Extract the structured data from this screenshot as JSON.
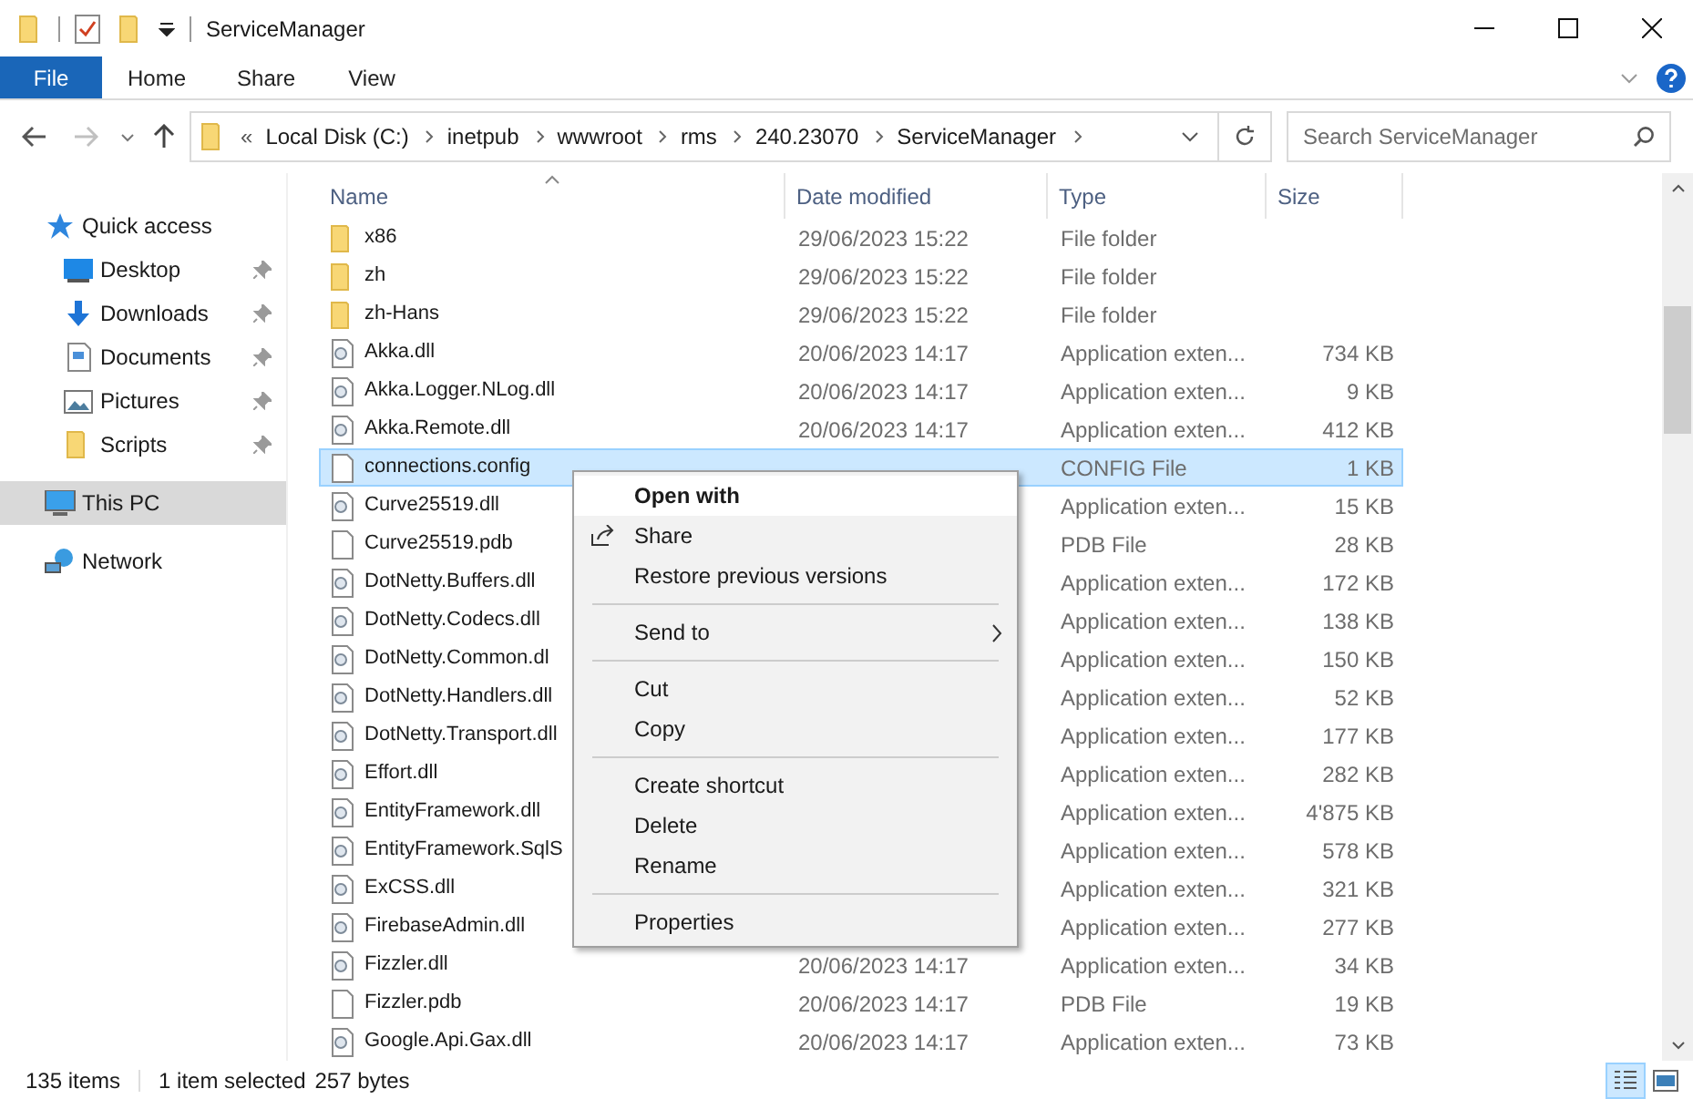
{
  "window": {
    "title": "ServiceManager"
  },
  "ribbon": {
    "tabs": [
      {
        "label": "File",
        "selected": true
      },
      {
        "label": "Home",
        "selected": false
      },
      {
        "label": "Share",
        "selected": false
      },
      {
        "label": "View",
        "selected": false
      }
    ]
  },
  "address": {
    "overflow": "«",
    "segments": [
      "Local Disk (C:)",
      "inetpub",
      "wwwroot",
      "rms",
      "240.23070",
      "ServiceManager"
    ],
    "search_placeholder": "Search ServiceManager"
  },
  "navigation": {
    "back_disabled": false,
    "forward_disabled": true
  },
  "sidebar": {
    "items": [
      {
        "label": "Quick access",
        "kind": "star",
        "selected": false,
        "children": [
          {
            "label": "Desktop",
            "kind": "desktop",
            "pinned": true,
            "selected": false
          },
          {
            "label": "Downloads",
            "kind": "download",
            "pinned": true,
            "selected": false
          },
          {
            "label": "Documents",
            "kind": "document",
            "pinned": true,
            "selected": false
          },
          {
            "label": "Pictures",
            "kind": "picture",
            "pinned": true,
            "selected": false
          },
          {
            "label": "Scripts",
            "kind": "folder",
            "pinned": true,
            "selected": false
          }
        ]
      },
      {
        "label": "This PC",
        "kind": "pc",
        "selected": true
      },
      {
        "label": "Network",
        "kind": "network",
        "selected": false
      }
    ]
  },
  "table": {
    "columns": [
      {
        "label": "Name",
        "sorted": true
      },
      {
        "label": "Date modified",
        "sorted": false
      },
      {
        "label": "Type",
        "sorted": false
      },
      {
        "label": "Size",
        "sorted": false
      }
    ],
    "rows": [
      {
        "name": "x86",
        "kind": "folder",
        "date": "29/06/2023 15:22",
        "type": "File folder",
        "selected": false
      },
      {
        "name": "zh",
        "kind": "folder",
        "date": "29/06/2023 15:22",
        "type": "File folder",
        "selected": false
      },
      {
        "name": "zh-Hans",
        "kind": "folder",
        "date": "29/06/2023 15:22",
        "type": "File folder",
        "selected": false
      },
      {
        "name": "Akka.dll",
        "kind": "dll",
        "date": "20/06/2023 14:17",
        "type": "Application exten...",
        "size": "734 KB",
        "selected": false
      },
      {
        "name": "Akka.Logger.NLog.dll",
        "kind": "dll",
        "date": "20/06/2023 14:17",
        "type": "Application exten...",
        "size": "9 KB",
        "selected": false
      },
      {
        "name": "Akka.Remote.dll",
        "kind": "dll",
        "date": "20/06/2023 14:17",
        "type": "Application exten...",
        "size": "412 KB",
        "selected": false
      },
      {
        "name": "connections.config",
        "kind": "file",
        "type": "CONFIG File",
        "size": "1 KB",
        "selected": true
      },
      {
        "name": "Curve25519.dll",
        "kind": "dll",
        "type": "Application exten...",
        "size": "15 KB",
        "selected": false
      },
      {
        "name": "Curve25519.pdb",
        "kind": "file",
        "type": "PDB File",
        "size": "28 KB",
        "selected": false
      },
      {
        "name": "DotNetty.Buffers.dll",
        "kind": "dll",
        "type": "Application exten...",
        "size": "172 KB",
        "selected": false
      },
      {
        "name": "DotNetty.Codecs.dll",
        "kind": "dll",
        "type": "Application exten...",
        "size": "138 KB",
        "selected": false
      },
      {
        "name": "DotNetty.Common.dl",
        "kind": "dll",
        "type": "Application exten...",
        "size": "150 KB",
        "selected": false
      },
      {
        "name": "DotNetty.Handlers.dll",
        "kind": "dll",
        "type": "Application exten...",
        "size": "52 KB",
        "selected": false
      },
      {
        "name": "DotNetty.Transport.dll",
        "kind": "dll",
        "type": "Application exten...",
        "size": "177 KB",
        "selected": false
      },
      {
        "name": "Effort.dll",
        "kind": "dll",
        "type": "Application exten...",
        "size": "282 KB",
        "selected": false
      },
      {
        "name": "EntityFramework.dll",
        "kind": "dll",
        "type": "Application exten...",
        "size": "4'875 KB",
        "selected": false
      },
      {
        "name": "EntityFramework.SqlS",
        "kind": "dll",
        "type": "Application exten...",
        "size": "578 KB",
        "selected": false
      },
      {
        "name": "ExCSS.dll",
        "kind": "dll",
        "type": "Application exten...",
        "size": "321 KB",
        "selected": false
      },
      {
        "name": "FirebaseAdmin.dll",
        "kind": "dll",
        "type": "Application exten...",
        "size": "277 KB",
        "selected": false
      },
      {
        "name": "Fizzler.dll",
        "kind": "dll",
        "date": "20/06/2023 14:17",
        "type": "Application exten...",
        "size": "34 KB",
        "selected": false
      },
      {
        "name": "Fizzler.pdb",
        "kind": "file",
        "date": "20/06/2023 14:17",
        "type": "PDB File",
        "size": "19 KB",
        "selected": false
      },
      {
        "name": "Google.Api.Gax.dll",
        "kind": "dll",
        "date": "20/06/2023 14:17",
        "type": "Application exten...",
        "size": "73 KB",
        "selected": false
      }
    ]
  },
  "context_menu": {
    "groups": [
      [
        {
          "label": "Open with",
          "kind": "default",
          "selected": true
        },
        {
          "label": "Share",
          "kind": "share",
          "selected": false
        },
        {
          "label": "Restore previous versions",
          "kind": "plain",
          "selected": false
        }
      ],
      [
        {
          "label": "Send to",
          "kind": "submenu",
          "selected": false
        }
      ],
      [
        {
          "label": "Cut",
          "kind": "plain",
          "selected": false
        },
        {
          "label": "Copy",
          "kind": "plain",
          "selected": false
        }
      ],
      [
        {
          "label": "Create shortcut",
          "kind": "plain",
          "selected": false
        },
        {
          "label": "Delete",
          "kind": "plain",
          "selected": false
        },
        {
          "label": "Rename",
          "kind": "plain",
          "selected": false
        }
      ],
      [
        {
          "label": "Properties",
          "kind": "plain",
          "selected": false
        }
      ]
    ]
  },
  "status_bar": {
    "count": "135 items",
    "selection": "1 item selected",
    "size": "257 bytes",
    "views": [
      {
        "kind": "details",
        "selected": true
      },
      {
        "kind": "large",
        "selected": false
      }
    ]
  }
}
